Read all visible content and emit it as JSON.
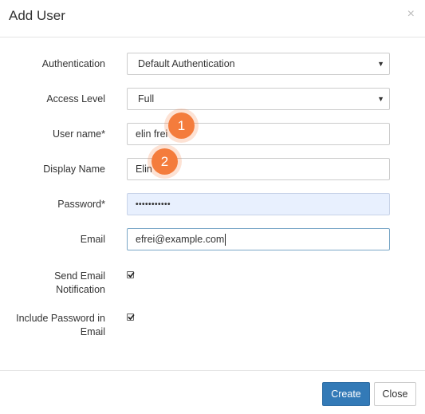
{
  "dialog": {
    "title": "Add User",
    "close_glyph": "×"
  },
  "form": {
    "authentication": {
      "label": "Authentication",
      "value": "Default Authentication"
    },
    "access_level": {
      "label": "Access Level",
      "value": "Full"
    },
    "user_name": {
      "label": "User name*",
      "value": "elin frei"
    },
    "display_name": {
      "label": "Display Name",
      "value": "Elin"
    },
    "password": {
      "label": "Password*",
      "masked_value": "•••••••••••"
    },
    "email": {
      "label": "Email",
      "value": "efrei@example.com"
    },
    "send_email_notification": {
      "label_line1": "Send Email",
      "label_line2": "Notification",
      "checked": true
    },
    "include_password": {
      "label_line1": "Include Password in",
      "label_line2": "Email",
      "checked": true
    }
  },
  "annotations": {
    "badge1": "1",
    "badge2": "2",
    "color": "#f47c3c"
  },
  "footer": {
    "create_label": "Create",
    "close_label": "Close"
  },
  "colors": {
    "primary": "#337ab7",
    "autofill": "#e8f0fe"
  }
}
